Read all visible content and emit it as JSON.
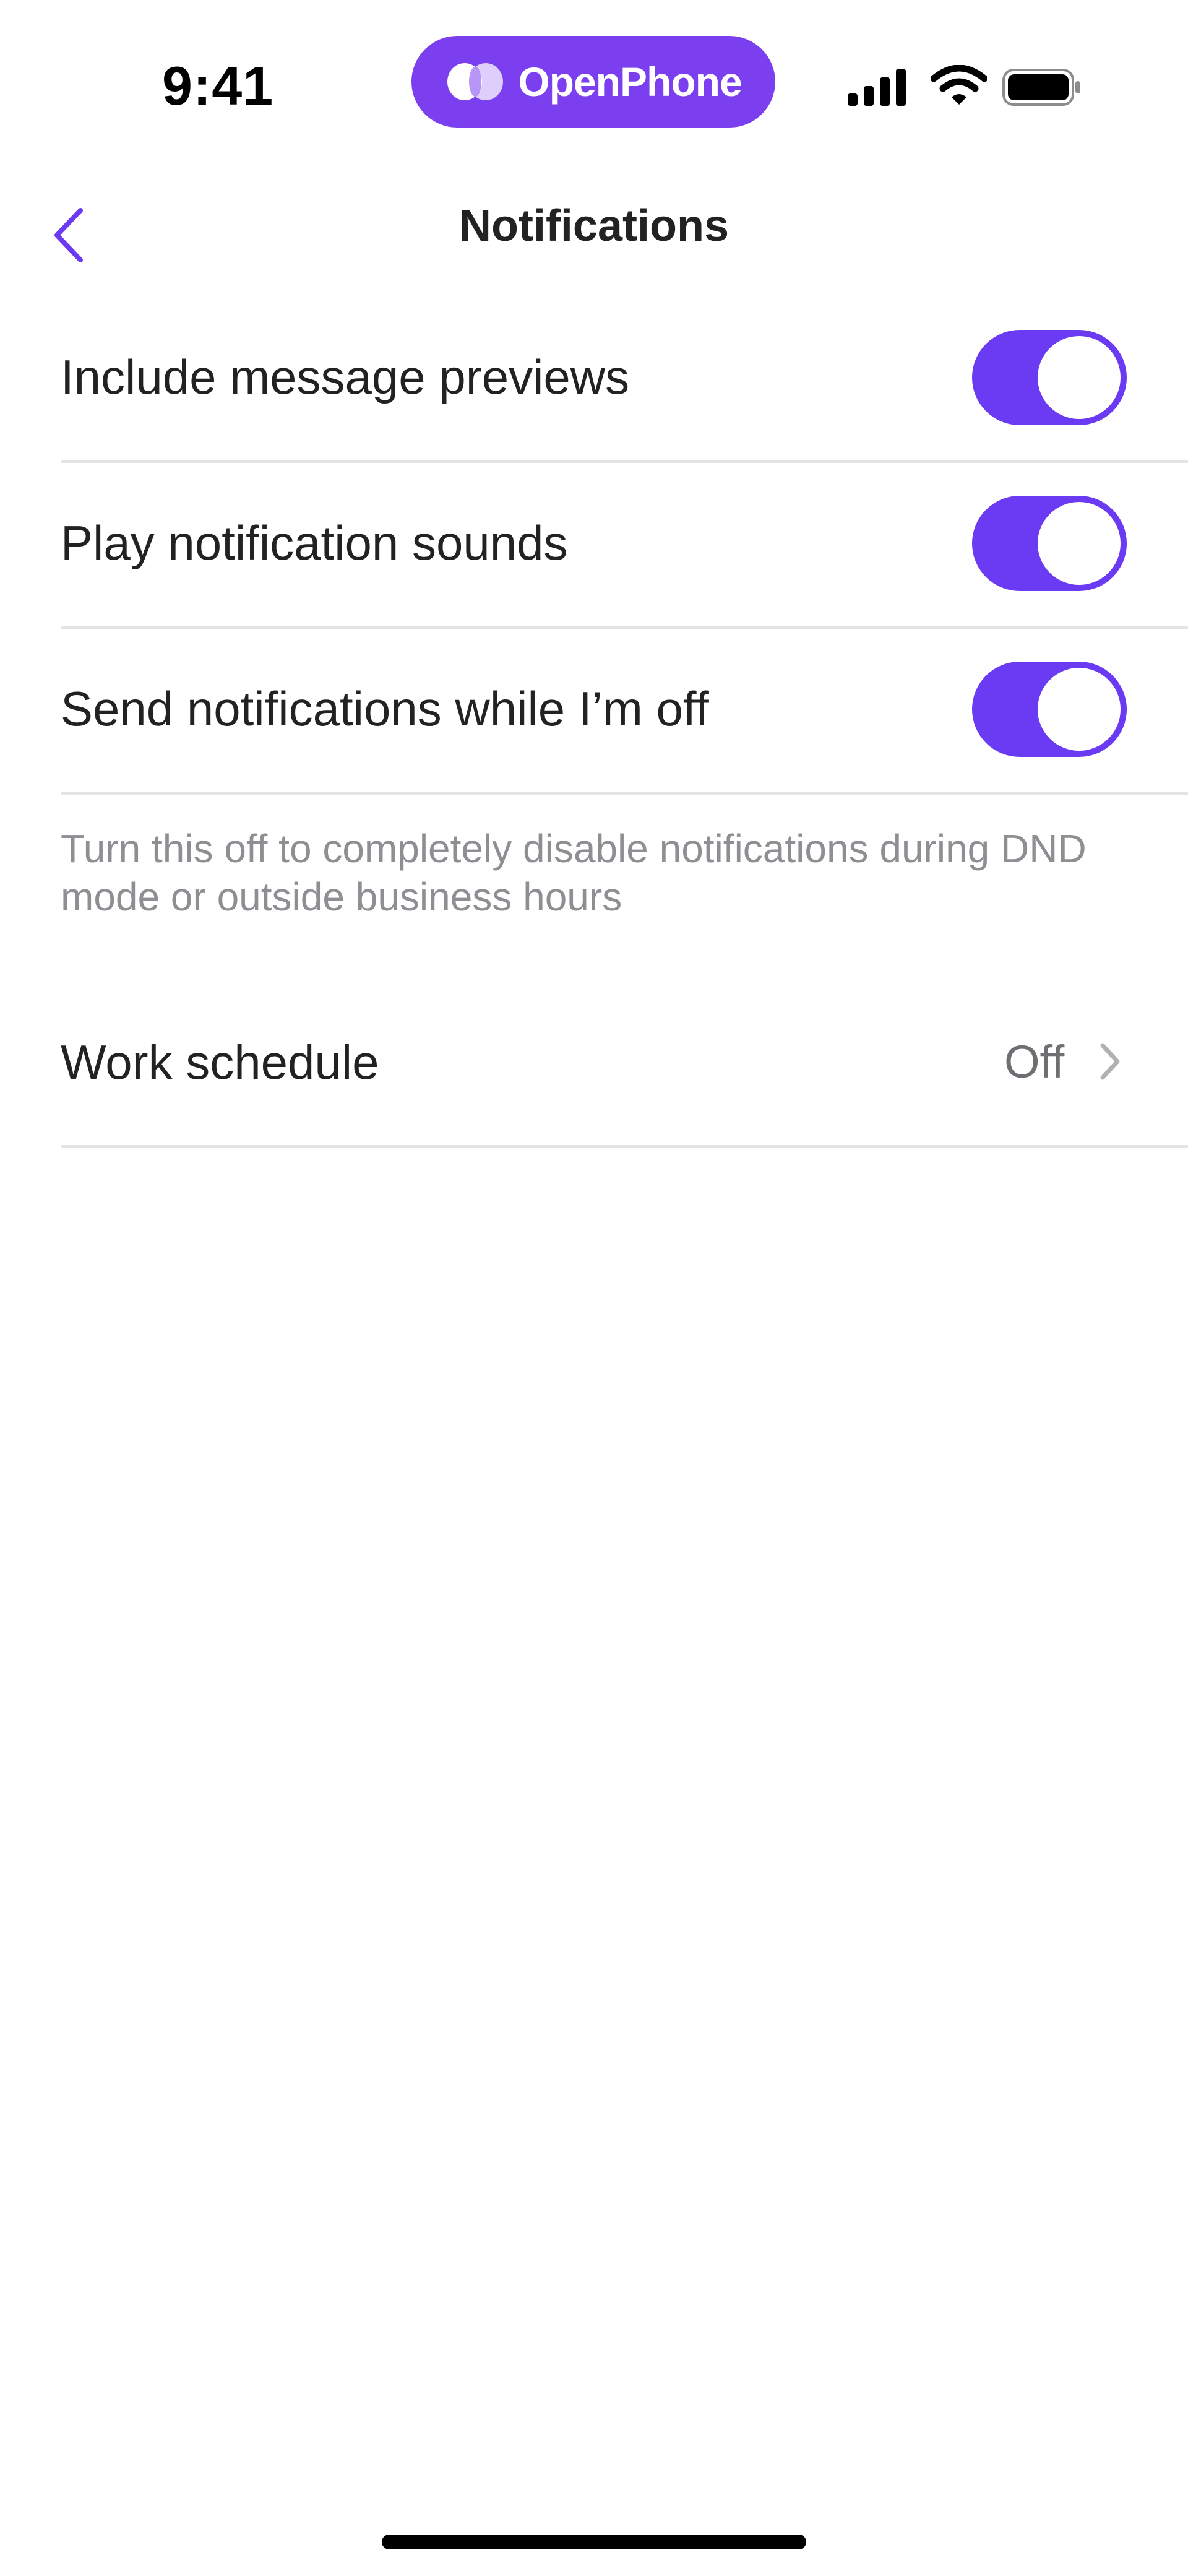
{
  "colors": {
    "brand": "#7b3ff0",
    "accent": "#6a3bf2"
  },
  "status_bar": {
    "time": "9:41",
    "brand_name": "OpenPhone",
    "icons": [
      "signal-icon",
      "wifi-icon",
      "battery-icon"
    ]
  },
  "nav": {
    "title": "Notifications",
    "back_icon": "chevron-left-icon"
  },
  "settings": [
    {
      "label": "Include message previews",
      "enabled": true
    },
    {
      "label": "Play notification sounds",
      "enabled": true
    },
    {
      "label": "Send notifications while I’m off",
      "enabled": true
    }
  ],
  "helper_text": "Turn this off to completely disable notifications during DND mode or outside business hours",
  "work_schedule": {
    "label": "Work schedule",
    "value": "Off"
  }
}
